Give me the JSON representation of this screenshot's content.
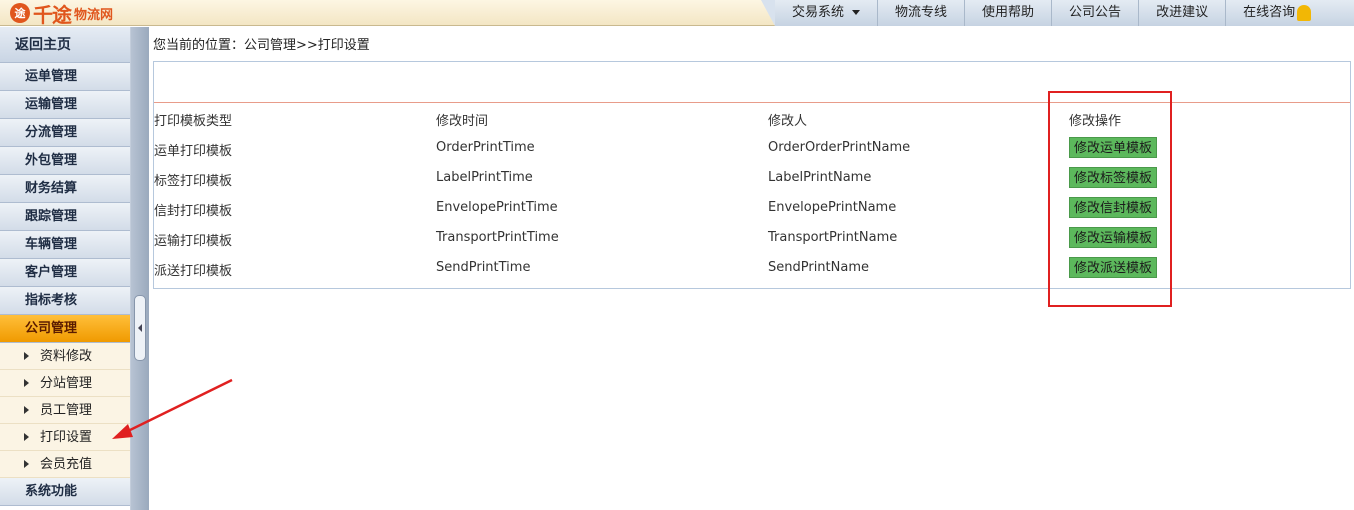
{
  "header": {
    "logo_mark": "途",
    "logo_big": "千途",
    "logo_small": "物流网",
    "nav": [
      {
        "label": "交易系统",
        "has_dropdown": true
      },
      {
        "label": "物流专线"
      },
      {
        "label": "使用帮助"
      },
      {
        "label": "公司公告"
      },
      {
        "label": "改进建议"
      },
      {
        "label": "在线咨询"
      }
    ]
  },
  "sidebar": {
    "home": "返回主页",
    "items": [
      {
        "label": "运单管理"
      },
      {
        "label": "运输管理"
      },
      {
        "label": "分流管理"
      },
      {
        "label": "外包管理"
      },
      {
        "label": "财务结算"
      },
      {
        "label": "跟踪管理"
      },
      {
        "label": "车辆管理"
      },
      {
        "label": "客户管理"
      },
      {
        "label": "指标考核"
      },
      {
        "label": "公司管理",
        "active": true
      }
    ],
    "sub_items": [
      {
        "label": "资料修改"
      },
      {
        "label": "分站管理"
      },
      {
        "label": "员工管理"
      },
      {
        "label": "打印设置"
      },
      {
        "label": "会员充值"
      }
    ],
    "after": "系统功能"
  },
  "main": {
    "breadcrumb": "您当前的位置：公司管理>>打印设置",
    "table": {
      "headers": [
        "打印模板类型",
        "修改时间",
        "修改人",
        "修改操作"
      ],
      "rows": [
        {
          "type": "运单打印模板",
          "time": "OrderPrintTime",
          "person": "OrderOrderPrintName",
          "action": "修改运单模板"
        },
        {
          "type": "标签打印模板",
          "time": "LabelPrintTime",
          "person": "LabelPrintName",
          "action": "修改标签模板"
        },
        {
          "type": "信封打印模板",
          "time": "EnvelopePrintTime",
          "person": "EnvelopePrintName",
          "action": "修改信封模板"
        },
        {
          "type": "运输打印模板",
          "time": "TransportPrintTime",
          "person": "TransportPrintName",
          "action": "修改运输模板"
        },
        {
          "type": "派送打印模板",
          "time": "SendPrintTime",
          "person": "SendPrintName",
          "action": "修改派送模板"
        }
      ]
    }
  },
  "colors": {
    "button_green": "#5cb85c",
    "highlight_red": "#e02020",
    "active_orange": "#f09a00"
  }
}
